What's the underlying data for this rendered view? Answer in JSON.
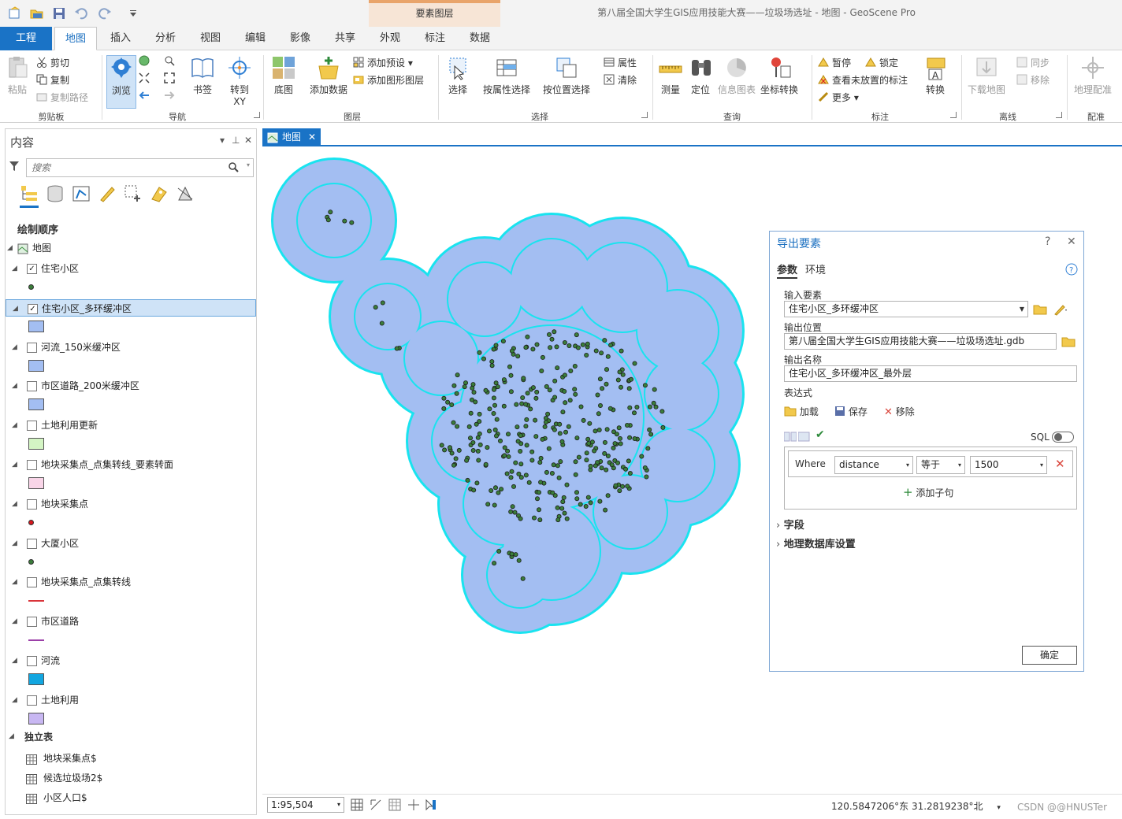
{
  "title_bar": {
    "window_title": "第八届全国大学生GIS应用技能大赛——垃圾场选址 - 地图 - GeoScene Pro",
    "context_group": "要素图层"
  },
  "tabs": [
    {
      "label": "工程"
    },
    {
      "label": "地图"
    },
    {
      "label": "插入"
    },
    {
      "label": "分析"
    },
    {
      "label": "视图"
    },
    {
      "label": "编辑"
    },
    {
      "label": "影像"
    },
    {
      "label": "共享"
    },
    {
      "label": "外观"
    },
    {
      "label": "标注"
    },
    {
      "label": "数据"
    }
  ],
  "ribbon": {
    "clipboard": {
      "paste": "粘贴",
      "cut": "剪切",
      "copy": "复制",
      "copy_path": "复制路径",
      "group": "剪贴板"
    },
    "navigate": {
      "explore": "浏览",
      "bookmarks": "书签",
      "goto": "转到",
      "goto_xy": "XY",
      "group": "导航"
    },
    "layer": {
      "basemap": "底图",
      "add_data": "添加数据",
      "add_preset": "添加预设",
      "add_graphics": "添加图形图层",
      "group": "图层"
    },
    "selection": {
      "select": "选择",
      "by_attr": "按属性选择",
      "by_loc": "按位置选择",
      "attributes": "属性",
      "clear": "清除",
      "group": "选择"
    },
    "inquiry": {
      "measure": "测量",
      "locate": "定位",
      "infographics": "信息图表",
      "coord_convert": "坐标转换",
      "group": "查询"
    },
    "labeling": {
      "pause": "暂停",
      "lock": "锁定",
      "view_unplaced": "查看未放置的标注",
      "more": "更多",
      "convert": "转换",
      "group": "标注"
    },
    "offline": {
      "download": "下载地图",
      "sync": "同步",
      "remove": "移除",
      "group": "离线"
    },
    "georef": {
      "label": "地理配准",
      "group": "配准"
    }
  },
  "contents": {
    "title": "内容",
    "search_placeholder": "搜索",
    "drawing_order": "绘制顺序",
    "map_name": "地图",
    "layers": [
      {
        "name": "住宅小区",
        "checked": "✓",
        "symbol": "point",
        "color": "#3a7d3a"
      },
      {
        "name": "住宅小区_多环缓冲区",
        "checked": "✓",
        "symbol": "fill",
        "color": "#a3bef2",
        "selected": true
      },
      {
        "name": "河流_150米缓冲区",
        "checked": "",
        "symbol": "fill",
        "color": "#a3bef2"
      },
      {
        "name": "市区道路_200米缓冲区",
        "checked": "",
        "symbol": "fill",
        "color": "#a3bef2"
      },
      {
        "name": "土地利用更新",
        "checked": "",
        "symbol": "fill",
        "color": "#d4f5c4"
      },
      {
        "name": "地块采集点_点集转线_要素转面",
        "checked": "",
        "symbol": "fill",
        "color": "#f9d5e8"
      },
      {
        "name": "地块采集点",
        "checked": "",
        "symbol": "point",
        "color": "#d9161c"
      },
      {
        "name": "大厦小区",
        "checked": "",
        "symbol": "point",
        "color": "#3a7d3a"
      },
      {
        "name": "地块采集点_点集转线",
        "checked": "",
        "symbol": "line",
        "color": "#d9343a"
      },
      {
        "name": "市区道路",
        "checked": "",
        "symbol": "line",
        "color": "#9b3fa8"
      },
      {
        "name": "河流",
        "checked": "",
        "symbol": "fill",
        "color": "#12a6e0"
      },
      {
        "name": "土地利用",
        "checked": "",
        "symbol": "fill",
        "color": "#c8b7f2"
      }
    ],
    "standalone_tables_header": "独立表",
    "tables": [
      "地块采集点$",
      "候选垃圾场2$",
      "小区人口$"
    ]
  },
  "map_view": {
    "tab_label": "地图",
    "scale": "1:95,504",
    "coordinates": "120.5847206°东 31.2819238°北",
    "watermark": "CSDN @@HNUSTer",
    "colors": {
      "buffer_outline": "#19e3ef",
      "buffer_fill": "#a3bef2",
      "point": "#3a7d3a"
    }
  },
  "dialog": {
    "title": "导出要素",
    "help": "?",
    "close": "✕",
    "tab_params": "参数",
    "tab_env": "环境",
    "input_label": "输入要素",
    "input_value": "住宅小区_多环缓冲区",
    "output_location_label": "输出位置",
    "output_location_value": "第八届全国大学生GIS应用技能大赛——垃圾场选址.gdb",
    "output_name_label": "输出名称",
    "output_name_value": "住宅小区_多环缓冲区_最外层",
    "expression_label": "表达式",
    "load": "加载",
    "save": "保存",
    "remove": "移除",
    "sql_label": "SQL",
    "clause": {
      "where": "Where",
      "field": "distance",
      "operator": "等于",
      "value": "1500"
    },
    "add_clause": "添加子句",
    "fields_section": "字段",
    "gdb_settings_section": "地理数据库设置",
    "ok": "确定"
  }
}
